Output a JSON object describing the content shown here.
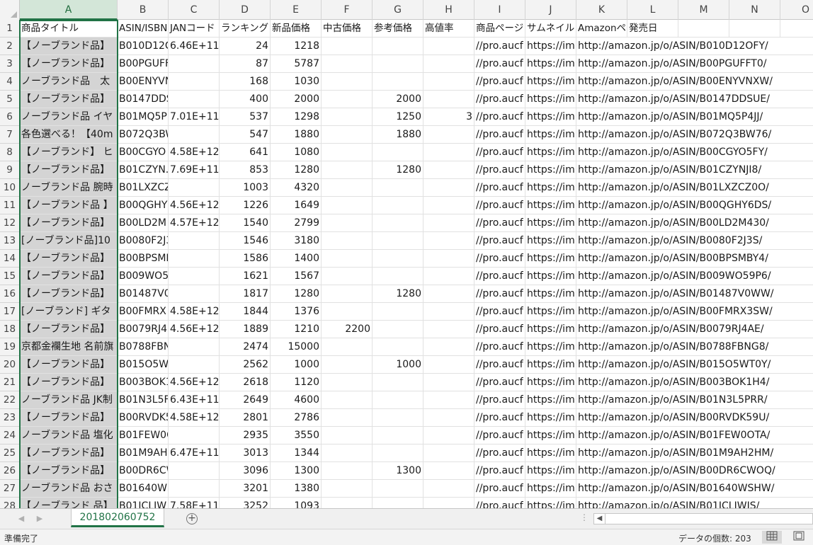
{
  "sheet": {
    "columns": [
      "A",
      "B",
      "C",
      "D",
      "E",
      "F",
      "G",
      "H",
      "I",
      "J",
      "K",
      "L",
      "M",
      "N",
      "O"
    ],
    "selected_column": "A",
    "header_row": {
      "row": "1",
      "cells": [
        "商品タイトル",
        "ASIN/ISBN",
        "JANコード",
        "ランキング",
        "新品価格",
        "中古価格",
        "参考価格",
        "高値率",
        "商品ページ",
        "サムネイル",
        "Amazonペ",
        "発売日",
        "",
        "",
        ""
      ]
    },
    "rows": [
      {
        "row": "2",
        "cells": [
          "【ノーブランド品】",
          "B010D12C",
          "6.46E+11",
          "24",
          "1218",
          "",
          "",
          "",
          "//pro.aucf",
          "https://im",
          "http://amazon.jp/o/ASIN/B010D12OFY/",
          "",
          "",
          "",
          ""
        ]
      },
      {
        "row": "3",
        "cells": [
          "【ノーブランド品】",
          "B00PGUFFT0",
          "",
          "87",
          "5787",
          "",
          "",
          "",
          "//pro.aucf",
          "https://im",
          "http://amazon.jp/o/ASIN/B00PGUFFT0/",
          "",
          "",
          "",
          ""
        ]
      },
      {
        "row": "4",
        "cells": [
          "ノーブランド品　太",
          "B00ENYVNXW",
          "",
          "168",
          "1030",
          "",
          "",
          "",
          "//pro.aucf",
          "https://im",
          "http://amazon.jp/o/ASIN/B00ENYVNXW/",
          "",
          "",
          "",
          ""
        ]
      },
      {
        "row": "5",
        "cells": [
          "【ノーブランド品】",
          "B0147DDSUE",
          "",
          "400",
          "2000",
          "",
          "2000",
          "",
          "//pro.aucf",
          "https://im",
          "http://amazon.jp/o/ASIN/B0147DDSUE/",
          "",
          "",
          "",
          ""
        ]
      },
      {
        "row": "6",
        "cells": [
          "ノーブランド品 イヤ",
          "B01MQ5P",
          "7.01E+11",
          "537",
          "1298",
          "",
          "1250",
          "3",
          "//pro.aucf",
          "https://im",
          "http://amazon.jp/o/ASIN/B01MQ5P4JJ/",
          "",
          "",
          "",
          ""
        ]
      },
      {
        "row": "7",
        "cells": [
          "各色選べる！【40m",
          "B072Q3BW76",
          "",
          "547",
          "1880",
          "",
          "1880",
          "",
          "//pro.aucf",
          "https://im",
          "http://amazon.jp/o/ASIN/B072Q3BW76/",
          "",
          "",
          "",
          ""
        ]
      },
      {
        "row": "8",
        "cells": [
          "【ノーブランド】 ヒ",
          "B00CGYO",
          "4.58E+12",
          "641",
          "1080",
          "",
          "",
          "",
          "//pro.aucf",
          "https://im",
          "http://amazon.jp/o/ASIN/B00CGYO5FY/",
          "",
          "",
          "",
          ""
        ]
      },
      {
        "row": "9",
        "cells": [
          "【ノーブランド品】",
          "B01CZYN.",
          "7.69E+11",
          "853",
          "1280",
          "",
          "1280",
          "",
          "//pro.aucf",
          "https://im",
          "http://amazon.jp/o/ASIN/B01CZYNJI8/",
          "",
          "",
          "",
          ""
        ]
      },
      {
        "row": "10",
        "cells": [
          "ノーブランド品 腕時",
          "B01LXZCZ0O",
          "",
          "1003",
          "4320",
          "",
          "",
          "",
          "//pro.aucf",
          "https://im",
          "http://amazon.jp/o/ASIN/B01LXZCZ0O/",
          "",
          "",
          "",
          ""
        ]
      },
      {
        "row": "11",
        "cells": [
          "【ノーブランド品 】",
          "B00QGHY",
          "4.56E+12",
          "1226",
          "1649",
          "",
          "",
          "",
          "//pro.aucf",
          "https://im",
          "http://amazon.jp/o/ASIN/B00QGHY6DS/",
          "",
          "",
          "",
          ""
        ]
      },
      {
        "row": "12",
        "cells": [
          "【ノーブランド品】",
          "B00LD2M",
          "4.57E+12",
          "1540",
          "2799",
          "",
          "",
          "",
          "//pro.aucf",
          "https://im",
          "http://amazon.jp/o/ASIN/B00LD2M430/",
          "",
          "",
          "",
          ""
        ]
      },
      {
        "row": "13",
        "cells": [
          "[ノーブランド品]10",
          "B0080F2J3S",
          "",
          "1546",
          "3180",
          "",
          "",
          "",
          "//pro.aucf",
          "https://im",
          "http://amazon.jp/o/ASIN/B0080F2J3S/",
          "",
          "",
          "",
          ""
        ]
      },
      {
        "row": "14",
        "cells": [
          "【ノーブランド品】",
          "B00BPSMBY4",
          "",
          "1586",
          "1400",
          "",
          "",
          "",
          "//pro.aucf",
          "https://im",
          "http://amazon.jp/o/ASIN/B00BPSMBY4/",
          "",
          "",
          "",
          ""
        ]
      },
      {
        "row": "15",
        "cells": [
          "【ノーブランド品】",
          "B009WO59P6",
          "",
          "1621",
          "1567",
          "",
          "",
          "",
          "//pro.aucf",
          "https://im",
          "http://amazon.jp/o/ASIN/B009WO59P6/",
          "",
          "",
          "",
          ""
        ]
      },
      {
        "row": "16",
        "cells": [
          "【ノーブランド品】",
          "B01487V0WW",
          "",
          "1817",
          "1280",
          "",
          "1280",
          "",
          "//pro.aucf",
          "https://im",
          "http://amazon.jp/o/ASIN/B01487V0WW/",
          "",
          "",
          "",
          ""
        ]
      },
      {
        "row": "17",
        "cells": [
          "[ノーブランド] ギタ",
          "B00FMRX",
          "4.58E+12",
          "1844",
          "1376",
          "",
          "",
          "",
          "//pro.aucf",
          "https://im",
          "http://amazon.jp/o/ASIN/B00FMRX3SW/",
          "",
          "",
          "",
          ""
        ]
      },
      {
        "row": "18",
        "cells": [
          "【ノーブランド品】",
          "B0079RJ4",
          "4.56E+12",
          "1889",
          "1210",
          "2200",
          "",
          "",
          "//pro.aucf",
          "https://im",
          "http://amazon.jp/o/ASIN/B0079RJ4AE/",
          "",
          "",
          "",
          ""
        ]
      },
      {
        "row": "19",
        "cells": [
          "京都金襴生地 名前旗",
          "B0788FBNG8",
          "",
          "2474",
          "15000",
          "",
          "",
          "",
          "//pro.aucf",
          "https://im",
          "http://amazon.jp/o/ASIN/B0788FBNG8/",
          "",
          "",
          "",
          ""
        ]
      },
      {
        "row": "20",
        "cells": [
          "【ノーブランド品】",
          "B015O5WT0Y",
          "",
          "2562",
          "1000",
          "",
          "1000",
          "",
          "//pro.aucf",
          "https://im",
          "http://amazon.jp/o/ASIN/B015O5WT0Y/",
          "",
          "",
          "",
          ""
        ]
      },
      {
        "row": "21",
        "cells": [
          "【ノーブランド品】",
          "B003BOK1",
          "4.56E+12",
          "2618",
          "1120",
          "",
          "",
          "",
          "//pro.aucf",
          "https://im",
          "http://amazon.jp/o/ASIN/B003BOK1H4/",
          "",
          "",
          "",
          ""
        ]
      },
      {
        "row": "22",
        "cells": [
          "ノーブランド品 JK制",
          "B01N3L5F",
          "6.43E+11",
          "2649",
          "4600",
          "",
          "",
          "",
          "//pro.aucf",
          "https://im",
          "http://amazon.jp/o/ASIN/B01N3L5PRR/",
          "",
          "",
          "",
          ""
        ]
      },
      {
        "row": "23",
        "cells": [
          "【ノーブランド品】",
          "B00RVDK5",
          "4.58E+12",
          "2801",
          "2786",
          "",
          "",
          "",
          "//pro.aucf",
          "https://im",
          "http://amazon.jp/o/ASIN/B00RVDK59U/",
          "",
          "",
          "",
          ""
        ]
      },
      {
        "row": "24",
        "cells": [
          "ノーブランド品 塩化",
          "B01FEW0OTA",
          "",
          "2935",
          "3550",
          "",
          "",
          "",
          "//pro.aucf",
          "https://im",
          "http://amazon.jp/o/ASIN/B01FEW0OTA/",
          "",
          "",
          "",
          ""
        ]
      },
      {
        "row": "25",
        "cells": [
          "【ノーブランド品】",
          "B01M9AH",
          "6.47E+11",
          "3013",
          "1344",
          "",
          "",
          "",
          "//pro.aucf",
          "https://im",
          "http://amazon.jp/o/ASIN/B01M9AH2HM/",
          "",
          "",
          "",
          ""
        ]
      },
      {
        "row": "26",
        "cells": [
          "【ノーブランド品】",
          "B00DR6CWOQ",
          "",
          "3096",
          "1300",
          "",
          "1300",
          "",
          "//pro.aucf",
          "https://im",
          "http://amazon.jp/o/ASIN/B00DR6CWOQ/",
          "",
          "",
          "",
          ""
        ]
      },
      {
        "row": "27",
        "cells": [
          "ノーブランド品 おさ",
          "B01640WSHW",
          "",
          "3201",
          "1380",
          "",
          "",
          "",
          "//pro.aucf",
          "https://im",
          "http://amazon.jp/o/ASIN/B01640WSHW/",
          "",
          "",
          "",
          ""
        ]
      },
      {
        "row": "28",
        "cells": [
          "【ノーブランド 品】",
          "B01ICLIW",
          "7.58E+11",
          "3252",
          "1093",
          "",
          "",
          "",
          "//pro.aucf",
          "https://im",
          "http://amazon.jp/o/ASIN/B01ICLIWIS/",
          "",
          "",
          "",
          ""
        ]
      }
    ]
  },
  "tabs": {
    "sheet_name": "201802060752",
    "add_symbol": "+",
    "prev_arrow": "◀",
    "next_arrow": "▶",
    "dots": "⋮",
    "scroll_left_arrow": "◀"
  },
  "status": {
    "ready": "準備完了",
    "count": "データの個数: 203"
  },
  "colors": {
    "accent": "#217346",
    "selected_column_bg": "#d4d4d4"
  },
  "icons": {
    "normal_view": "grid-view-icon",
    "page_layout": "page-layout-icon"
  }
}
